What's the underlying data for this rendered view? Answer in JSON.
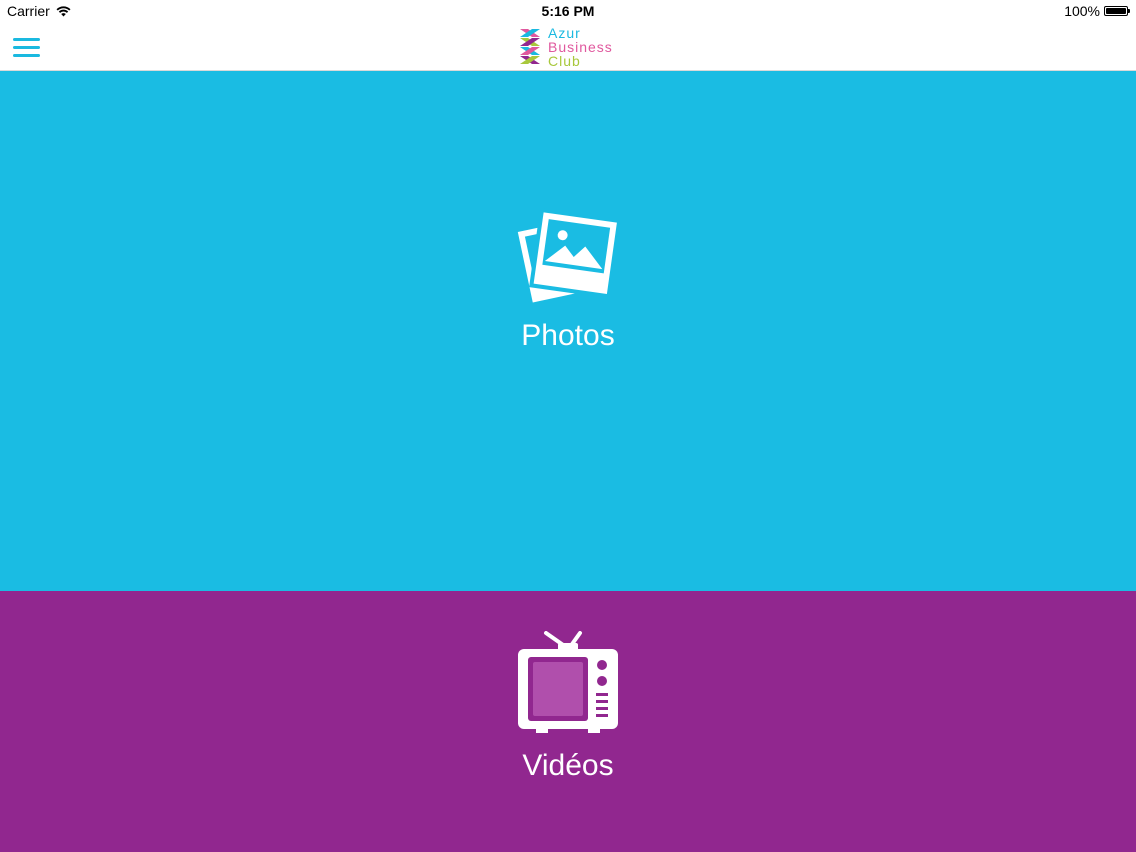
{
  "status_bar": {
    "carrier": "Carrier",
    "time": "5:16 PM",
    "battery": "100%"
  },
  "nav": {
    "menu_icon": "hamburger-menu-icon",
    "logo": {
      "line1": "Azur",
      "line2": "Business",
      "line3": "Club"
    }
  },
  "tiles": [
    {
      "label": "Photos",
      "icon": "photos-icon",
      "color": "#1abce3"
    },
    {
      "label": "Vidéos",
      "icon": "tv-icon",
      "color": "#91278f"
    }
  ],
  "colors": {
    "accent": "#1ab9e0",
    "purple": "#91278f"
  }
}
